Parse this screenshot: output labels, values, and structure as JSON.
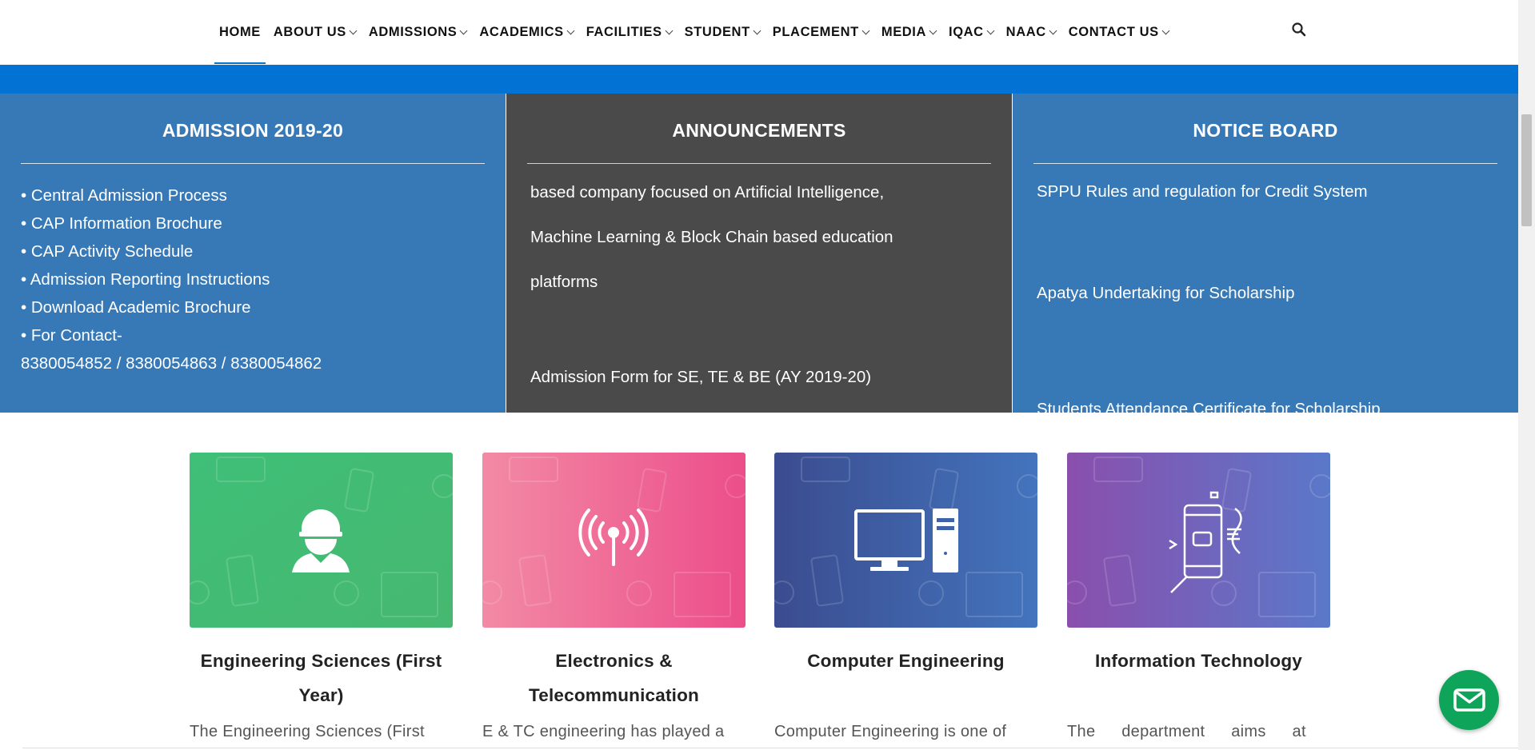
{
  "nav": {
    "items": [
      {
        "label": "HOME",
        "active": true,
        "dropdown": false
      },
      {
        "label": "ABOUT US",
        "dropdown": true
      },
      {
        "label": "ADMISSIONS",
        "dropdown": true
      },
      {
        "label": "ACADEMICS",
        "dropdown": true
      },
      {
        "label": "FACILITIES",
        "dropdown": true
      },
      {
        "label": "STUDENT",
        "dropdown": true
      },
      {
        "label": "PLACEMENT",
        "dropdown": true
      },
      {
        "label": "MEDIA",
        "dropdown": true
      },
      {
        "label": "IQAC",
        "dropdown": true
      },
      {
        "label": "NAAC",
        "dropdown": true
      },
      {
        "label": "CONTACT US",
        "dropdown": true
      }
    ],
    "search_icon": "search-icon"
  },
  "admission": {
    "title": "ADMISSION 2019-20",
    "items": [
      "• Central Admission Process",
      "• CAP Information Brochure",
      "• CAP Activity Schedule",
      "• Admission Reporting Instructions",
      "• Download Academic Brochure",
      "• For Contact-",
      "8380054852 / 8380054863 / 8380054862"
    ]
  },
  "announcements": {
    "title": "ANNOUNCEMENTS",
    "lines": [
      "based company focused on Artificial Intelligence,",
      "Machine Learning & Block Chain based education",
      "platforms",
      "Admission Form for SE, TE & BE (AY 2019-20)"
    ]
  },
  "notice_board": {
    "title": "NOTICE BOARD",
    "items": [
      "SPPU Rules and regulation for Credit System",
      "Apatya Undertaking for Scholarship",
      "Students Attendance Certificate for Scholarship"
    ]
  },
  "departments": [
    {
      "title": "Engineering Sciences (First Year)",
      "desc": "The Engineering Sciences (First",
      "icon": "engineer-icon",
      "color": "#3dbb72"
    },
    {
      "title": "Electronics & Telecommunication",
      "desc": "E & TC engineering has played a",
      "icon": "antenna-icon",
      "color": "#ee5d8e"
    },
    {
      "title": "Computer Engineering",
      "desc": "Computer Engineering is one of",
      "icon": "computer-icon",
      "color": "#3f63a8"
    },
    {
      "title": "Information Technology",
      "desc": "The department aims at",
      "icon": "mobile-icon",
      "color": "#7a5cb3"
    }
  ],
  "colors": {
    "nav_accent": "#0272d4",
    "panel_blue": "#3779b7",
    "panel_dark": "#4a4a4a",
    "chat_button": "#0ea55a"
  },
  "chat_icon": "mail-icon"
}
